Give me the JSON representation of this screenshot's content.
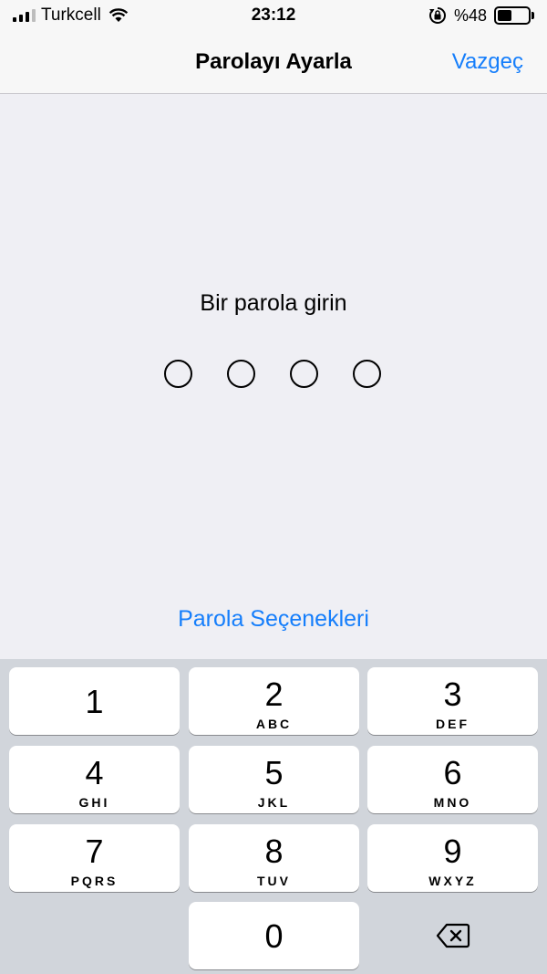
{
  "status": {
    "carrier": "Turkcell",
    "time": "23:12",
    "battery_text": "%48",
    "battery_level": 0.48
  },
  "nav": {
    "title": "Parolayı Ayarla",
    "cancel_label": "Vazgeç"
  },
  "prompt": "Bir parola girin",
  "passcode_length": 4,
  "options_label": "Parola Seçenekleri",
  "keypad": {
    "keys": [
      {
        "digit": "1",
        "letters": ""
      },
      {
        "digit": "2",
        "letters": "ABC"
      },
      {
        "digit": "3",
        "letters": "DEF"
      },
      {
        "digit": "4",
        "letters": "GHI"
      },
      {
        "digit": "5",
        "letters": "JKL"
      },
      {
        "digit": "6",
        "letters": "MNO"
      },
      {
        "digit": "7",
        "letters": "PQRS"
      },
      {
        "digit": "8",
        "letters": "TUV"
      },
      {
        "digit": "9",
        "letters": "WXYZ"
      },
      {
        "digit": "0",
        "letters": ""
      }
    ],
    "delete_icon": "backspace-icon"
  },
  "colors": {
    "accent": "#157efb",
    "background": "#efeff4",
    "keypad_background": "#d1d5db"
  }
}
